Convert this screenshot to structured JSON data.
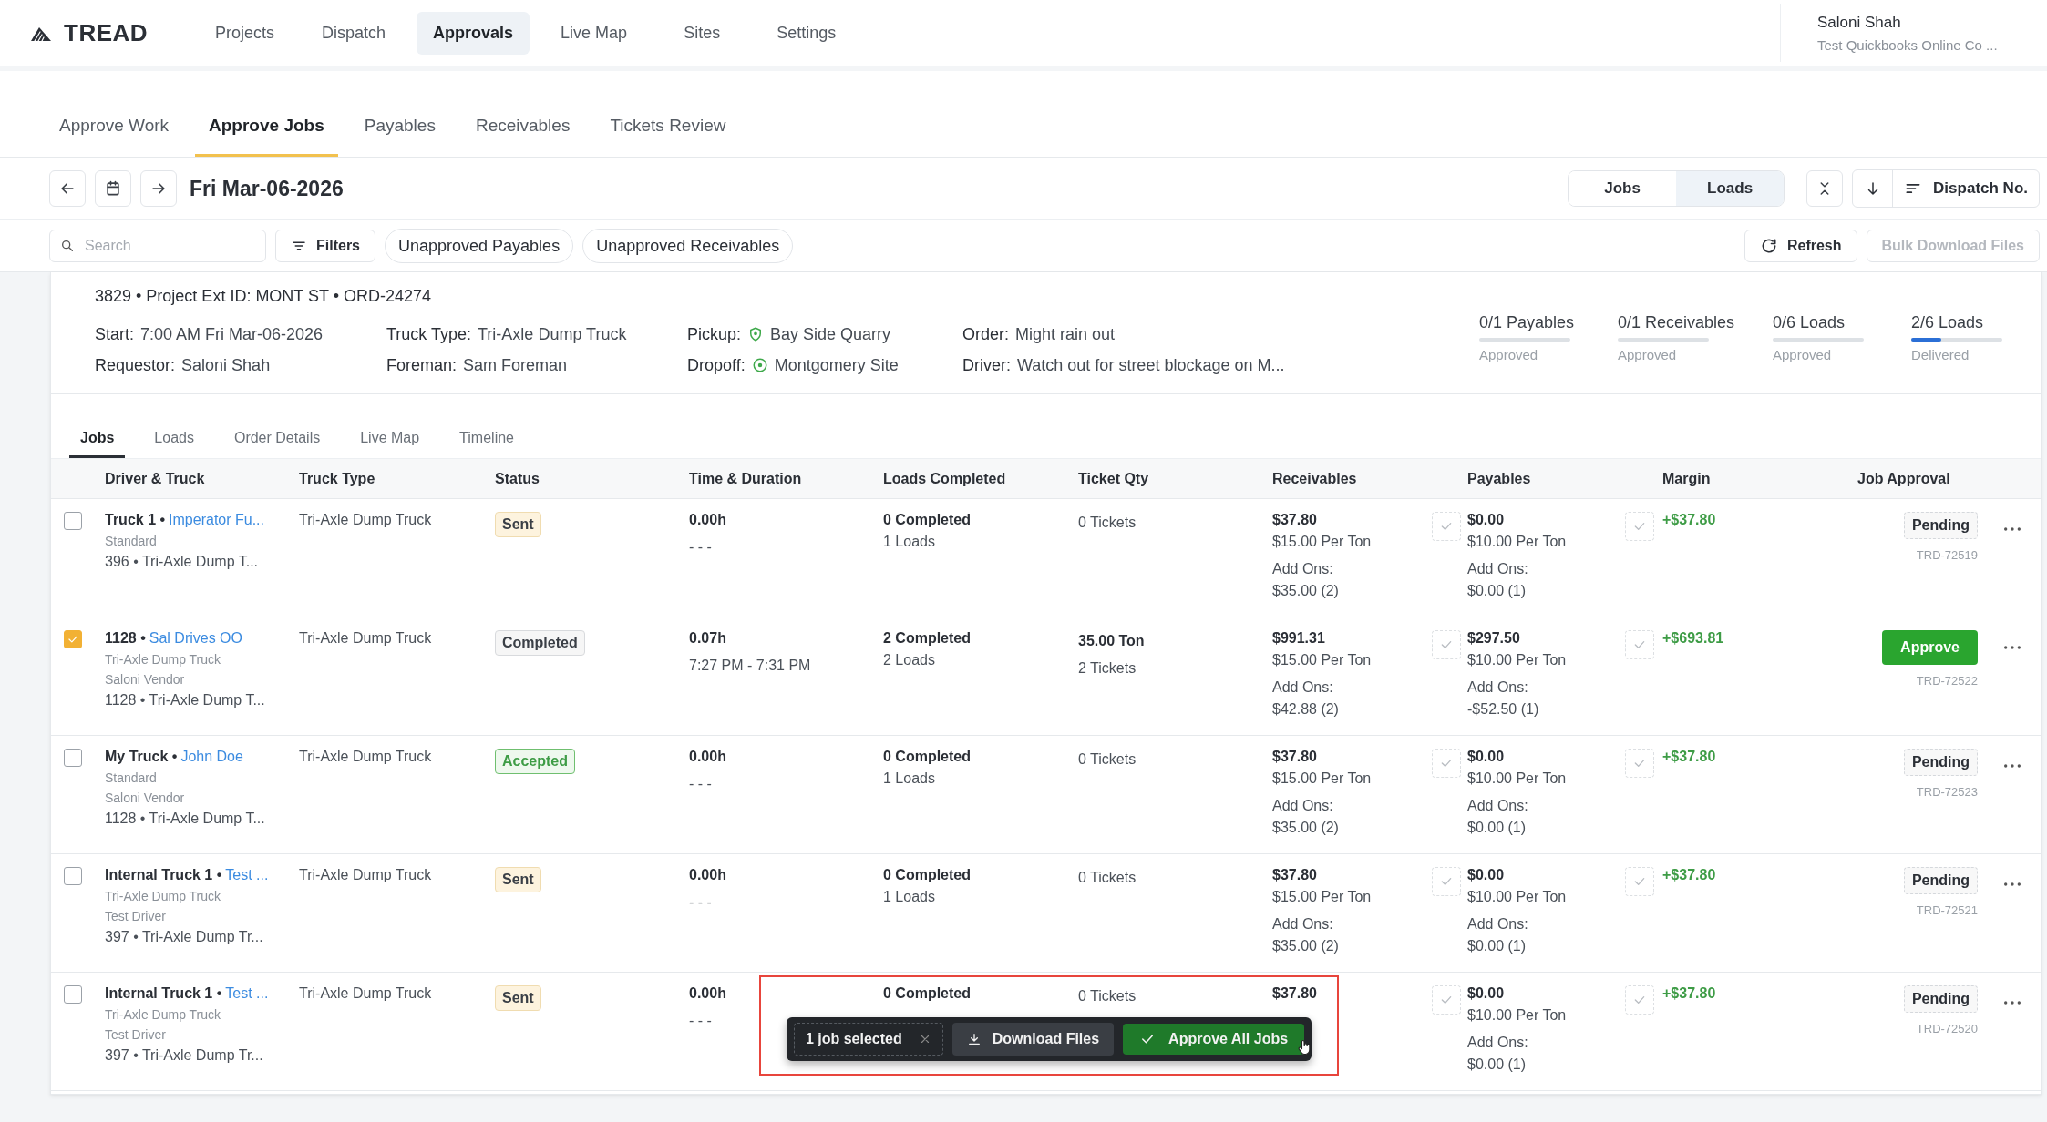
{
  "top_nav": {
    "logo": "TREAD",
    "items": [
      {
        "label": "Projects",
        "selected": false
      },
      {
        "label": "Dispatch",
        "selected": false
      },
      {
        "label": "Approvals",
        "selected": true
      },
      {
        "label": "Live Map",
        "selected": false
      },
      {
        "label": "Sites",
        "selected": false
      },
      {
        "label": "Settings",
        "selected": false
      }
    ],
    "user": {
      "name": "Saloni Shah",
      "company": "Test Quickbooks Online Co ..."
    }
  },
  "sub_tabs": [
    {
      "label": "Approve Work",
      "selected": false
    },
    {
      "label": "Approve Jobs",
      "selected": true
    },
    {
      "label": "Payables",
      "selected": false
    },
    {
      "label": "Receivables",
      "selected": false
    },
    {
      "label": "Tickets Review",
      "selected": false
    }
  ],
  "date_bar": {
    "date": "Fri Mar-06-2026",
    "view_toggle": [
      {
        "label": "Jobs",
        "selected": false
      },
      {
        "label": "Loads",
        "selected": true
      }
    ],
    "sort_label": "Dispatch No."
  },
  "filter_bar": {
    "search": {
      "placeholder": "Search"
    },
    "filters": "Filters",
    "chips": [
      "Unapproved Payables",
      "Unapproved Receivables"
    ],
    "refresh": "Refresh",
    "bulk_download": {
      "label": "Bulk Download Files",
      "disabled": true
    }
  },
  "order": {
    "ids_line": "3829 • Project Ext ID: MONT ST • ORD-24274",
    "details": [
      {
        "kind": "text",
        "label": "Start:",
        "value": "7:00 AM Fri Mar-06-2026"
      },
      {
        "kind": "text",
        "label": "Requestor:",
        "value": "Saloni Shah"
      },
      {
        "kind": "text",
        "label": "Truck Type:",
        "value": "Tri-Axle Dump Truck"
      },
      {
        "kind": "text",
        "label": "Foreman:",
        "value": "Sam Foreman"
      },
      {
        "kind": "pickup",
        "label": "Pickup:",
        "value": "Bay Side Quarry"
      },
      {
        "kind": "dropoff",
        "label": "Dropoff:",
        "value": "Montgomery Site"
      },
      {
        "kind": "text",
        "label": "Order:",
        "value": "Might rain out"
      },
      {
        "kind": "text",
        "label": "Driver:",
        "value": "Watch out for street blockage on M..."
      }
    ],
    "progress": [
      {
        "value": "0/1 Payables",
        "caption": "Approved",
        "level": 0
      },
      {
        "value": "0/1 Receivables",
        "caption": "Approved",
        "level": 0
      },
      {
        "value": "0/6 Loads",
        "caption": "Approved",
        "level": 0
      },
      {
        "value": "2/6 Loads",
        "caption": "Delivered",
        "level": 0.33
      }
    ]
  },
  "detail_tabs": [
    {
      "label": "Jobs",
      "selected": true
    },
    {
      "label": "Loads",
      "selected": false
    },
    {
      "label": "Order Details",
      "selected": false
    },
    {
      "label": "Live Map",
      "selected": false
    },
    {
      "label": "Timeline",
      "selected": false
    }
  ],
  "table": {
    "columns": [
      "Driver & Truck",
      "Truck Type",
      "Status",
      "Time & Duration",
      "Loads Completed",
      "Ticket Qty",
      "Receivables",
      "Payables",
      "Margin",
      "Job Approval"
    ],
    "rows": [
      {
        "selected": false,
        "truck": "Truck 1 •",
        "driver": "Imperator Fu...",
        "lines": [
          {
            "kind": "muted",
            "text": "Standard"
          },
          {
            "kind": "plain",
            "text": "396 • Tri-Axle Dump T..."
          }
        ],
        "truck_type": "Tri-Axle Dump Truck",
        "status": {
          "kind": "sent",
          "label": "Sent"
        },
        "hours": "0.00h",
        "time_range": "- - -",
        "loads_completed": "0 Completed",
        "loads_total": "1 Loads",
        "tickets": [
          "0 Tickets"
        ],
        "receivable": {
          "amount": "$37.80",
          "rate": "$15.00 Per Ton",
          "addons_label": "Add Ons:",
          "addons": "$35.00 (2)"
        },
        "payable": {
          "amount": "$0.00",
          "rate": "$10.00 Per Ton",
          "addons_label": "Add Ons:",
          "addons": "$0.00 (1)"
        },
        "margin": "+$37.80",
        "approval": {
          "kind": "pending",
          "label": "Pending"
        },
        "trd": "TRD-72519"
      },
      {
        "selected": true,
        "truck": "1128 •",
        "driver": "Sal Drives OO",
        "lines": [
          {
            "kind": "muted",
            "text": "Tri-Axle Dump Truck"
          },
          {
            "kind": "muted",
            "text": "Saloni Vendor"
          },
          {
            "kind": "plain",
            "text": "1128 • Tri-Axle Dump T..."
          }
        ],
        "truck_type": "Tri-Axle Dump Truck",
        "status": {
          "kind": "completed",
          "label": "Completed"
        },
        "hours": "0.07h",
        "time_range": "7:27 PM - 7:31 PM",
        "loads_completed": "2 Completed",
        "loads_total": "2 Loads",
        "tickets": [
          "35.00 Ton",
          "2 Tickets"
        ],
        "receivable": {
          "amount": "$991.31",
          "rate": "$15.00 Per Ton",
          "addons_label": "Add Ons:",
          "addons": "$42.88 (2)"
        },
        "payable": {
          "amount": "$297.50",
          "rate": "$10.00 Per Ton",
          "addons_label": "Add Ons:",
          "addons": "-$52.50 (1)"
        },
        "margin": "+$693.81",
        "approval": {
          "kind": "approve",
          "label": "Approve"
        },
        "trd": "TRD-72522"
      },
      {
        "selected": false,
        "truck": "My Truck •",
        "driver": "John Doe",
        "lines": [
          {
            "kind": "muted",
            "text": "Standard"
          },
          {
            "kind": "muted",
            "text": "Saloni Vendor"
          },
          {
            "kind": "plain",
            "text": "1128 • Tri-Axle Dump T..."
          }
        ],
        "truck_type": "Tri-Axle Dump Truck",
        "status": {
          "kind": "accepted",
          "label": "Accepted"
        },
        "hours": "0.00h",
        "time_range": "- - -",
        "loads_completed": "0 Completed",
        "loads_total": "1 Loads",
        "tickets": [
          "0 Tickets"
        ],
        "receivable": {
          "amount": "$37.80",
          "rate": "$15.00 Per Ton",
          "addons_label": "Add Ons:",
          "addons": "$35.00 (2)"
        },
        "payable": {
          "amount": "$0.00",
          "rate": "$10.00 Per Ton",
          "addons_label": "Add Ons:",
          "addons": "$0.00 (1)"
        },
        "margin": "+$37.80",
        "approval": {
          "kind": "pending",
          "label": "Pending"
        },
        "trd": "TRD-72523"
      },
      {
        "selected": false,
        "truck": "Internal Truck 1 •",
        "driver": "Test ...",
        "lines": [
          {
            "kind": "muted",
            "text": "Tri-Axle Dump Truck"
          },
          {
            "kind": "muted",
            "text": "Test Driver"
          },
          {
            "kind": "plain",
            "text": "397 • Tri-Axle Dump Tr..."
          }
        ],
        "truck_type": "Tri-Axle Dump Truck",
        "status": {
          "kind": "sent",
          "label": "Sent"
        },
        "hours": "0.00h",
        "time_range": "- - -",
        "loads_completed": "0 Completed",
        "loads_total": "1 Loads",
        "tickets": [
          "0 Tickets"
        ],
        "receivable": {
          "amount": "$37.80",
          "rate": "$15.00 Per Ton",
          "addons_label": "Add Ons:",
          "addons": "$35.00 (2)"
        },
        "payable": {
          "amount": "$0.00",
          "rate": "$10.00 Per Ton",
          "addons_label": "Add Ons:",
          "addons": "$0.00 (1)"
        },
        "margin": "+$37.80",
        "approval": {
          "kind": "pending",
          "label": "Pending"
        },
        "trd": "TRD-72521"
      },
      {
        "selected": false,
        "truck": "Internal Truck 1 •",
        "driver": "Test ...",
        "lines": [
          {
            "kind": "muted",
            "text": "Tri-Axle Dump Truck"
          },
          {
            "kind": "muted",
            "text": "Test Driver"
          },
          {
            "kind": "plain",
            "text": "397 • Tri-Axle Dump Tr..."
          }
        ],
        "truck_type": "Tri-Axle Dump Truck",
        "status": {
          "kind": "sent",
          "label": "Sent"
        },
        "hours": "0.00h",
        "time_range": "- - -",
        "loads_completed": "0 Completed",
        "tickets": [
          "0 Tickets"
        ],
        "receivable": {
          "amount": "$37.80"
        },
        "payable": {
          "amount": "$0.00",
          "rate": "$10.00 Per Ton",
          "addons_label": "Add Ons:",
          "addons": "$0.00 (1)"
        },
        "margin": "+$37.80",
        "approval": {
          "kind": "pending",
          "label": "Pending"
        },
        "trd": "TRD-72520"
      }
    ]
  },
  "selection_bar": {
    "count_label": "1 job selected",
    "download": "Download Files",
    "approve_all": "Approve All Jobs"
  }
}
